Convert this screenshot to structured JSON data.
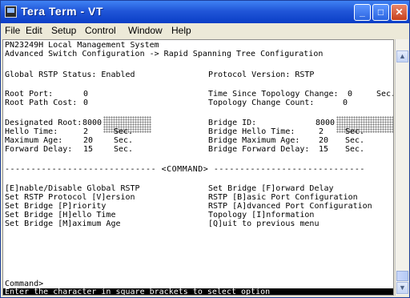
{
  "window": {
    "title": "Tera Term - VT",
    "controls": {
      "minimize": "_",
      "maximize": "□",
      "close": "✕"
    }
  },
  "menubar": [
    "File",
    "Edit",
    "Setup",
    "Control",
    "Window",
    "Help"
  ],
  "terminal": {
    "device": "PN23249H Local Management System",
    "path": "Advanced Switch Configuration -> Rapid Spanning Tree Configuration",
    "global_status": "Global RSTP Status: Enabled",
    "protocol_version": "Protocol Version: RSTP",
    "root_port_label": "Root Port:",
    "root_port_value": "0",
    "root_path_cost_label": "Root Path Cost:",
    "root_path_cost_value": "0",
    "tsc_label": "Time Since Topology Change:",
    "tsc_value": "0",
    "tsc_unit": "Sec.",
    "tcc_label": "Topology Change Count:",
    "tcc_value": "0",
    "designated_root_label": "Designated Root:",
    "designated_root_value": "8000",
    "bridge_id_label": "Bridge ID:",
    "bridge_id_value": "8000",
    "hello_time_label": "Hello Time:",
    "hello_time_value": "2",
    "hello_time_unit": "Sec.",
    "max_age_label": "Maximum Age:",
    "max_age_value": "20",
    "max_age_unit": "Sec.",
    "fwd_delay_label": "Forward Delay:",
    "fwd_delay_value": "15",
    "fwd_delay_unit": "Sec.",
    "bridge_hello_label": "Bridge Hello Time:",
    "bridge_hello_value": "2",
    "bridge_hello_unit": "Sec.",
    "bridge_max_age_label": "Bridge Maximum Age:",
    "bridge_max_age_value": "20",
    "bridge_max_age_unit": "Sec.",
    "bridge_fwd_label": "Bridge Forward Delay:",
    "bridge_fwd_value": "15",
    "bridge_fwd_unit": "Sec.",
    "command_divider": "----------------------------- <COMMAND> -----------------------------",
    "commands_left": [
      "[E]nable/Disable Global RSTP",
      "Set RSTP Protocol [V]ersion",
      "Set Bridge [P]riority",
      "Set Bridge [H]ello Time",
      "Set Bridge [M]aximum Age"
    ],
    "commands_right": [
      "Set Bridge [F]orward Delay",
      "RSTP [B]asic Port Configuration",
      "RSTP [A]dvanced Port Configuration",
      "Topology [I]nformation",
      "[Q]uit to previous menu"
    ],
    "prompt": "Command>",
    "status_line": "Enter the character in square brackets to select option"
  },
  "colors": {
    "titlebar": "#0a3ec6",
    "terminal_bg": "#ffffff",
    "status_bg": "#000000"
  },
  "icons": [
    "tera-term-icon",
    "minimize-icon",
    "maximize-icon",
    "close-icon",
    "scroll-up-icon",
    "scroll-down-icon"
  ]
}
